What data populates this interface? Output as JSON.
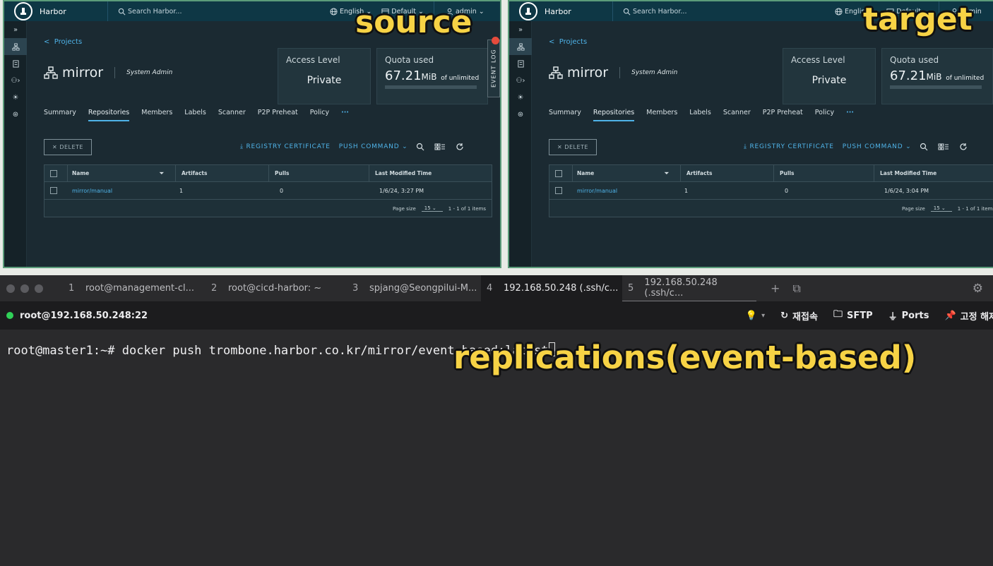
{
  "overlays": {
    "source": "source",
    "target": "target",
    "replications": "replications(event-based)"
  },
  "harbor": {
    "brand": "Harbor",
    "search_placeholder": "Search Harbor...",
    "language": "English",
    "project_scope": "Default",
    "user": "admin",
    "breadcrumb": "Projects",
    "project_name": "mirror",
    "role": "System Admin",
    "access_level_title": "Access Level",
    "access_level_value": "Private",
    "quota_title": "Quota used",
    "quota_value": "67.21",
    "quota_unit": "MiB",
    "quota_limit": "of unlimited",
    "tabs": [
      "Summary",
      "Repositories",
      "Members",
      "Labels",
      "Scanner",
      "P2P Preheat",
      "Policy",
      "···"
    ],
    "delete_label": "DELETE",
    "registry_certificate": "REGISTRY CERTIFICATE",
    "push_command": "PUSH COMMAND",
    "columns": [
      "Name",
      "Artifacts",
      "Pulls",
      "Last Modified Time"
    ],
    "page_size_label": "Page size",
    "page_size_value": "15",
    "items_count": "1 - 1 of 1 items",
    "event_log": "EVENT LOG"
  },
  "source_row": {
    "name": "mirror/manual",
    "artifacts": "1",
    "pulls": "0",
    "modified": "1/6/24, 3:27 PM"
  },
  "target_row": {
    "name": "mirror/manual",
    "artifacts": "1",
    "pulls": "0",
    "modified": "1/6/24, 3:04 PM"
  },
  "terminal": {
    "tabs": [
      {
        "num": "1",
        "label": "root@management-cl..."
      },
      {
        "num": "2",
        "label": "root@cicd-harbor: ~"
      },
      {
        "num": "3",
        "label": "spjang@Seongpilui-M..."
      },
      {
        "num": "4",
        "label": "192.168.50.248 (.ssh/c..."
      },
      {
        "num": "5",
        "label": "192.168.50.248 (.ssh/c..."
      }
    ],
    "session": "root@192.168.50.248:22",
    "reconnect": "재접속",
    "sftp": "SFTP",
    "ports": "Ports",
    "pin": "고정 해제",
    "command": "root@master1:~# docker push trombone.harbor.co.kr/mirror/event-based:latest"
  }
}
